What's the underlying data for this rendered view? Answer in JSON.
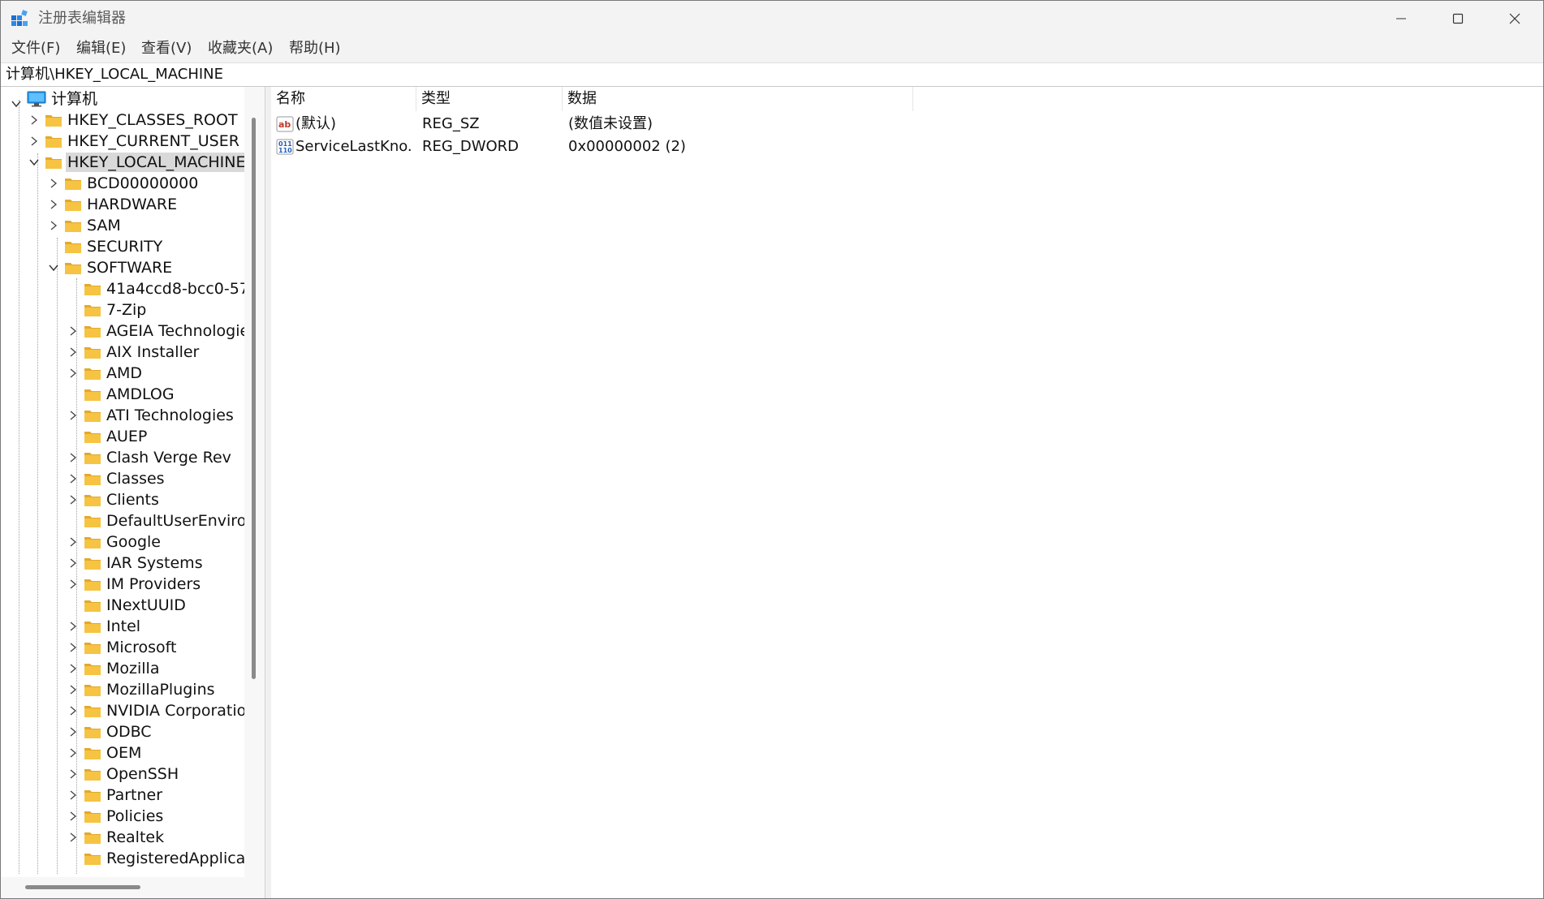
{
  "window": {
    "title": "注册表编辑器",
    "controls": {
      "minimize": "minimize-icon",
      "maximize": "maximize-icon",
      "close": "close-icon"
    }
  },
  "menu": [
    {
      "label": "文件(F)"
    },
    {
      "label": "编辑(E)"
    },
    {
      "label": "查看(V)"
    },
    {
      "label": "收藏夹(A)"
    },
    {
      "label": "帮助(H)"
    }
  ],
  "address": {
    "path": "计算机\\HKEY_LOCAL_MACHINE"
  },
  "tree": {
    "root": "计算机",
    "hives": [
      {
        "label": "HKEY_CLASSES_ROOT",
        "expandable": true
      },
      {
        "label": "HKEY_CURRENT_USER",
        "expandable": true
      },
      {
        "label": "HKEY_LOCAL_MACHINE",
        "expanded": true,
        "selected": true
      }
    ],
    "hklm_children": [
      {
        "label": "BCD00000000",
        "expandable": true
      },
      {
        "label": "HARDWARE",
        "expandable": true
      },
      {
        "label": "SAM",
        "expandable": true
      },
      {
        "label": "SECURITY",
        "expandable": false
      },
      {
        "label": "SOFTWARE",
        "expanded": true
      }
    ],
    "software_children": [
      {
        "label": "41a4ccd8-bcc0-57",
        "expandable": false
      },
      {
        "label": "7-Zip",
        "expandable": false
      },
      {
        "label": "AGEIA Technologies",
        "expandable": true
      },
      {
        "label": "AIX Installer",
        "expandable": true
      },
      {
        "label": "AMD",
        "expandable": true
      },
      {
        "label": "AMDLOG",
        "expandable": false
      },
      {
        "label": "ATI Technologies",
        "expandable": true
      },
      {
        "label": "AUEP",
        "expandable": false
      },
      {
        "label": "Clash Verge Rev",
        "expandable": true
      },
      {
        "label": "Classes",
        "expandable": true
      },
      {
        "label": "Clients",
        "expandable": true
      },
      {
        "label": "DefaultUserEnviron",
        "expandable": false
      },
      {
        "label": "Google",
        "expandable": true
      },
      {
        "label": "IAR Systems",
        "expandable": true
      },
      {
        "label": "IM Providers",
        "expandable": true
      },
      {
        "label": "INextUUID",
        "expandable": false
      },
      {
        "label": "Intel",
        "expandable": true
      },
      {
        "label": "Microsoft",
        "expandable": true
      },
      {
        "label": "Mozilla",
        "expandable": true
      },
      {
        "label": "MozillaPlugins",
        "expandable": true
      },
      {
        "label": "NVIDIA Corporation",
        "expandable": true
      },
      {
        "label": "ODBC",
        "expandable": true
      },
      {
        "label": "OEM",
        "expandable": true
      },
      {
        "label": "OpenSSH",
        "expandable": true
      },
      {
        "label": "Partner",
        "expandable": true
      },
      {
        "label": "Policies",
        "expandable": true
      },
      {
        "label": "Realtek",
        "expandable": true
      },
      {
        "label": "RegisteredApplicat",
        "expandable": false
      }
    ]
  },
  "values": {
    "columns": [
      "名称",
      "类型",
      "数据"
    ],
    "rows": [
      {
        "name": "(默认)",
        "type": "REG_SZ",
        "data": "(数值未设置)",
        "icon": "string-value-icon"
      },
      {
        "name": "ServiceLastKno...",
        "type": "REG_DWORD",
        "data": "0x00000002 (2)",
        "icon": "binary-value-icon"
      }
    ]
  },
  "colors": {
    "folder": "#f6c343",
    "folder_dark": "#e2a92a",
    "selection": "#d9d9d9",
    "accent": "#0067c0"
  }
}
